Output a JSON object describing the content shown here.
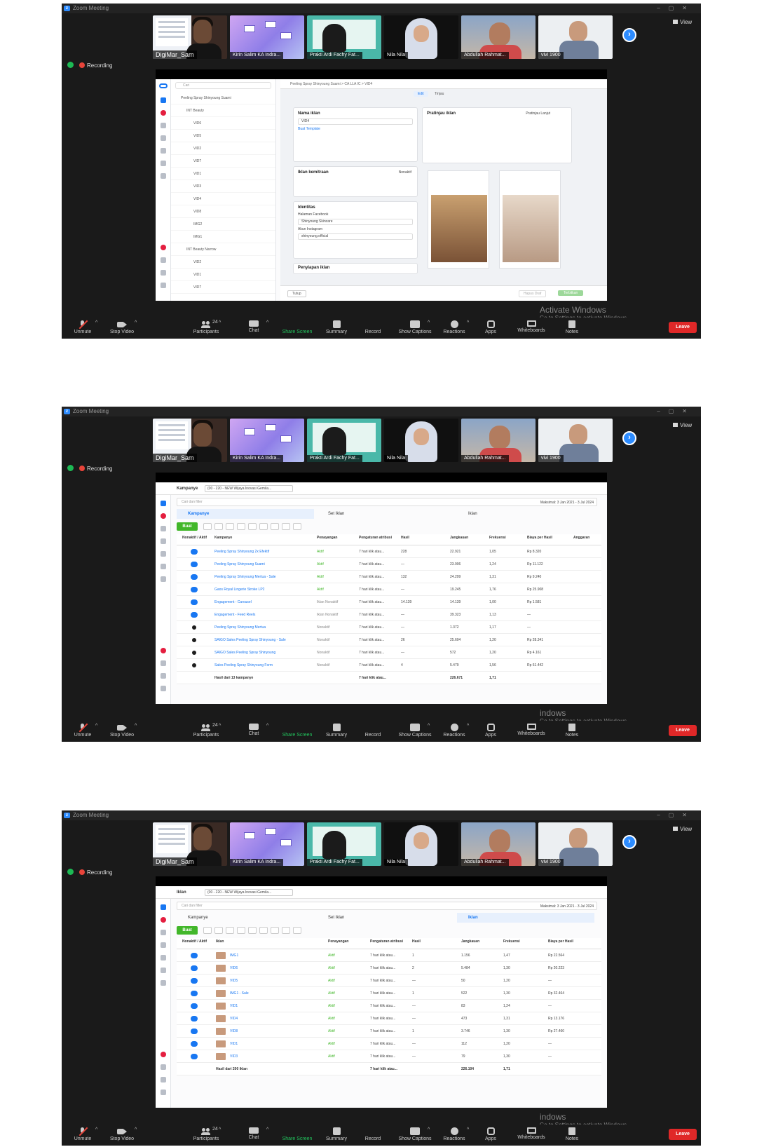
{
  "screenshots": [
    {
      "window_title": "Zoom Meeting",
      "view_label": "View",
      "recording_label": "Recording",
      "participants": [
        "DigiMar_Sam",
        "Kirin Salim KA Indra...",
        "Prakti Ardi Fachy Fat...",
        "Nila Nila",
        "Abdullah Rahmat...",
        "vivi 1900"
      ],
      "screen_share": {
        "mode": "ad_editor",
        "search_placeholder": "Cari",
        "breadcrumb": "Peeling Spray Shinyoung Suami  >  CA LLA IC  >  VID4",
        "tree": [
          {
            "label": "Peeling Spray Shinyoung Suami",
            "level": 1
          },
          {
            "label": "INT Beauty",
            "level": 2
          },
          {
            "label": "VID6",
            "level": 3
          },
          {
            "label": "VID5",
            "level": 3
          },
          {
            "label": "VID2",
            "level": 3
          },
          {
            "label": "VID7",
            "level": 3
          },
          {
            "label": "VID1",
            "level": 3
          },
          {
            "label": "VID3",
            "level": 3
          },
          {
            "label": "VID4",
            "level": 3
          },
          {
            "label": "VID8",
            "level": 3
          },
          {
            "label": "IMG2",
            "level": 3
          },
          {
            "label": "IMG1",
            "level": 3
          },
          {
            "label": "INT Beauty Narrow",
            "level": 2
          },
          {
            "label": "VID2",
            "level": 3
          },
          {
            "label": "VID1",
            "level": 3
          },
          {
            "label": "VID7",
            "level": 3
          }
        ],
        "edit_label": "Edit",
        "review_label": "Tinjau",
        "ad_name_heading": "Nama iklan",
        "ad_name_value": "VID4",
        "template_link": "Buat Template",
        "partnership_heading": "Iklan kemitraan",
        "partnership_status": "Nonaktif",
        "identity_heading": "Identitas",
        "facebook_page_label": "Halaman Facebook",
        "facebook_page_value": "Shinyoung Skincare",
        "instagram_label": "Akun Instagram",
        "instagram_value": "shinyoung.official",
        "placement_heading": "Penyiapan iklan",
        "preview_label": "Pratinjau iklan",
        "advanced_preview": "Pratinjau Lanjut",
        "close_button": "Tutup",
        "publish_button": "Terbitkan",
        "discard_button": "Hapus Draf"
      },
      "toolbar": {
        "unmute": "Unmute",
        "stop_video": "Stop Video",
        "participants": "Participants",
        "participant_count": "24",
        "chat": "Chat",
        "share_screen": "Share Screen",
        "summary": "Summary",
        "record": "Record",
        "show_captions": "Show Captions",
        "reactions": "Reactions",
        "apps": "Apps",
        "whiteboards": "Whiteboards",
        "notes": "Notes",
        "leave": "Leave"
      },
      "watermark": {
        "line1": "Activate Windows",
        "line2": "Go to Settings to activate Windows."
      }
    },
    {
      "window_title": "Zoom Meeting",
      "view_label": "View",
      "recording_label": "Recording",
      "participants": [
        "DigiMar_Sam",
        "Kirin Salim KA Indra...",
        "Prakti Ardi Fachy Fat...",
        "Nila Nila",
        "Abdullah Rahmat...",
        "vivi 1900"
      ],
      "screen_share": {
        "mode": "campaigns_table",
        "level_label": "Kampanye",
        "account_dropdown": "(00 - 220 - NEW Wijaya Inovasi Gemila...",
        "filter_placeholder": "Cari dan filter",
        "date_range": "Maksimal: 3 Jan 2021 - 3 Jul 2024",
        "tabs": [
          "Kampanye",
          "Set Iklan",
          "Iklan"
        ],
        "active_tab": 0,
        "create_button": "Buat",
        "columns": [
          "Nonaktif / Aktif",
          "Kampanye",
          "Penayangan",
          "Pengaturan atribusi",
          "Hasil",
          "Jangkauan",
          "Frekuensi",
          "Biaya per Hasil",
          "Anggaran"
        ],
        "rows": [
          {
            "on": true,
            "name": "Peeling Spray Shinyoung 2x Efektif",
            "status": "Aktif",
            "attr": "7 hari klik atau...",
            "results": "228",
            "reach": "22.921",
            "freq": "1,05",
            "cpr": "Rp 8.320"
          },
          {
            "on": true,
            "name": "Peeling Spray Shinyoung Suami",
            "status": "Aktif",
            "attr": "7 hari klik atau...",
            "results": "—",
            "reach": "23.906",
            "freq": "1,24",
            "cpr": "Rp 11.122"
          },
          {
            "on": true,
            "name": "Peeling Spray Shinyoung Mertua - Sale",
            "status": "Aktif",
            "attr": "7 hari klik atau...",
            "results": "132",
            "reach": "24.299",
            "freq": "1,31",
            "cpr": "Rp 9.240"
          },
          {
            "on": true,
            "name": "Gaos Royal Lingerie Stroke LP2",
            "status": "Aktif",
            "attr": "7 hari klik atau...",
            "results": "—",
            "reach": "19.245",
            "freq": "1,76",
            "cpr": "Rp 25.908"
          },
          {
            "on": true,
            "name": "Engagement - Carousel",
            "status": "Iklan Nonaktif",
            "attr": "7 hari klik atau...",
            "results": "14.139",
            "reach": "14.139",
            "freq": "1,00",
            "cpr": "Rp 1.581"
          },
          {
            "on": true,
            "name": "Engagement - Feed Reels",
            "status": "Iklan Nonaktif",
            "attr": "7 hari klik atau...",
            "results": "—",
            "reach": "39.323",
            "freq": "1,13",
            "cpr": "—"
          },
          {
            "on": false,
            "name": "Peeling Spray Shinyoung Mertua",
            "status": "Nonaktif",
            "attr": "7 hari klik atau...",
            "results": "—",
            "reach": "1.372",
            "freq": "1,17",
            "cpr": "—"
          },
          {
            "on": false,
            "name": "SAIGO Sales Peeling Spray Shinyoung - Sale",
            "status": "Nonaktif",
            "attr": "7 hari klik atau...",
            "results": "26",
            "reach": "25.604",
            "freq": "1,20",
            "cpr": "Rp 28.341"
          },
          {
            "on": false,
            "name": "SAIGO Sales Peeling Spray Shinyoung",
            "status": "Nonaktif",
            "attr": "7 hari klik atau...",
            "results": "—",
            "reach": "572",
            "freq": "1,20",
            "cpr": "Rp 4.161"
          },
          {
            "on": false,
            "name": "Sales Peeling Spray Shinyoung Form",
            "status": "Nonaktif",
            "attr": "7 hari klik atau...",
            "results": "4",
            "reach": "5.479",
            "freq": "1,56",
            "cpr": "Rp 61.442"
          }
        ],
        "total_row": {
          "name": "Hasil dari 13 kampanye",
          "attr": "7 hari klik atau...",
          "reach": "226.671",
          "freq": "1,71"
        }
      },
      "toolbar": {
        "unmute": "Unmute",
        "stop_video": "Stop Video",
        "participants": "Participants",
        "participant_count": "24",
        "chat": "Chat",
        "share_screen": "Share Screen",
        "summary": "Summary",
        "record": "Record",
        "show_captions": "Show Captions",
        "reactions": "Reactions",
        "apps": "Apps",
        "whiteboards": "Whiteboards",
        "notes": "Notes",
        "leave": "Leave"
      },
      "watermark": {
        "line1": "indows",
        "line2": "Go to Settings to activate Windows."
      }
    },
    {
      "window_title": "Zoom Meeting",
      "view_label": "View",
      "recording_label": "Recording",
      "participants": [
        "DigiMar_Sam",
        "Kirin Salim KA Indra...",
        "Prakti Ardi Fachy Fat...",
        "Nila Nila",
        "Abdullah Rahmat...",
        "vivi 1900"
      ],
      "screen_share": {
        "mode": "ads_table",
        "level_label": "Iklan",
        "account_dropdown": "(00 - 220 - NEW Wijaya Inovasi Gemila...",
        "filter_placeholder": "Cari dan filter",
        "date_range": "Maksimal: 3 Jan 2021 - 3 Jul 2024",
        "tabs": [
          "Kampanye",
          "Set Iklan",
          "Iklan"
        ],
        "active_tab": 2,
        "create_button": "Buat",
        "columns": [
          "Nonaktif / Aktif",
          "Iklan",
          "Penayangan",
          "Pengaturan atribusi",
          "Hasil",
          "Jangkauan",
          "Frekuensi",
          "Biaya per Hasil"
        ],
        "rows": [
          {
            "on": true,
            "name": "IMG1",
            "status": "Aktif",
            "attr": "7 hari klik atau...",
            "results": "1",
            "reach": "1.156",
            "freq": "1,47",
            "cpr": "Rp 22.564"
          },
          {
            "on": true,
            "name": "VID6",
            "status": "Aktif",
            "attr": "7 hari klik atau...",
            "results": "2",
            "reach": "5.484",
            "freq": "1,30",
            "cpr": "Rp 20.223"
          },
          {
            "on": true,
            "name": "VID5",
            "status": "Aktif",
            "attr": "7 hari klik atau...",
            "results": "—",
            "reach": "50",
            "freq": "1,20",
            "cpr": "—"
          },
          {
            "on": true,
            "name": "IMG1 - Sale",
            "status": "Aktif",
            "attr": "7 hari klik atau...",
            "results": "1",
            "reach": "522",
            "freq": "1,30",
            "cpr": "Rp 32.464"
          },
          {
            "on": true,
            "name": "VID1",
            "status": "Aktif",
            "attr": "7 hari klik atau...",
            "results": "—",
            "reach": "83",
            "freq": "1,24",
            "cpr": "—"
          },
          {
            "on": true,
            "name": "VID4",
            "status": "Aktif",
            "attr": "7 hari klik atau...",
            "results": "—",
            "reach": "473",
            "freq": "1,31",
            "cpr": "Rp 13.176"
          },
          {
            "on": true,
            "name": "VID8",
            "status": "Aktif",
            "attr": "7 hari klik atau...",
            "results": "1",
            "reach": "3.746",
            "freq": "1,30",
            "cpr": "Rp 27.460"
          },
          {
            "on": true,
            "name": "VID1",
            "status": "Aktif",
            "attr": "7 hari klik atau...",
            "results": "—",
            "reach": "112",
            "freq": "1,20",
            "cpr": "—"
          },
          {
            "on": true,
            "name": "VID3",
            "status": "Aktif",
            "attr": "7 hari klik atau...",
            "results": "—",
            "reach": "79",
            "freq": "1,30",
            "cpr": "—"
          }
        ],
        "total_row": {
          "name": "Hasil dari 200 iklan",
          "attr": "7 hari klik atau...",
          "reach": "226.104",
          "freq": "1,71"
        }
      },
      "toolbar": {
        "unmute": "Unmute",
        "stop_video": "Stop Video",
        "participants": "Participants",
        "participant_count": "24",
        "chat": "Chat",
        "share_screen": "Share Screen",
        "summary": "Summary",
        "record": "Record",
        "show_captions": "Show Captions",
        "reactions": "Reactions",
        "apps": "Apps",
        "whiteboards": "Whiteboards",
        "notes": "Notes",
        "leave": "Leave"
      },
      "watermark": {
        "line1": "indows",
        "line2": "Go to Settings to activate Windows."
      }
    }
  ]
}
